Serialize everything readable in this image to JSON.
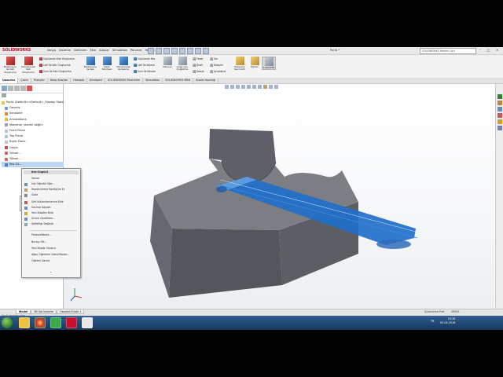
{
  "app": {
    "logo_text": "SOLIDWORKS",
    "document_title": "Part4 *",
    "search_placeholder": "SOLIDWORKS Yardım'ı Ara",
    "window_buttons": [
      "–",
      "□",
      "×"
    ]
  },
  "menu": [
    "Dosya",
    "Düzenle",
    "Görünüm",
    "Ekle",
    "Araçlar",
    "Simulation",
    "Pencere",
    "Yardım"
  ],
  "ribbon": {
    "large": [
      {
        "label": "Ekstrüzyon\nile Katı\nOluşturma",
        "icon": "extrude-boss-icon"
      },
      {
        "label": "Döndürerek\nKatı\nOluşturma",
        "icon": "revolve-boss-icon"
      },
      {
        "label": "Ekstrüzyon\nile Kes",
        "icon": "extrude-cut-icon"
      },
      {
        "label": "Delik\nSihirbazı",
        "icon": "hole-wizard-icon"
      },
      {
        "label": "Döndürerek\nile Kesme",
        "icon": "revolve-cut-icon"
      },
      {
        "label": "Referans\nGeometri",
        "icon": "reference-geometry-icon"
      },
      {
        "label": "Eğriler",
        "icon": "curves-icon"
      },
      {
        "label": "Instant3D",
        "icon": "instant3d-icon"
      }
    ],
    "small_col1": [
      "Süpürerek Katı Oluşturma",
      "Loft İle Katı Oluşturma",
      "Sınır İle Katı Oluşturma"
    ],
    "small_col2": [
      "Süpürerek Kes",
      "Loft İle Kesme",
      "Sınır İle Kesme"
    ],
    "small_col3": [
      "Radyus",
      "Doğrusal Çoğaltma"
    ],
    "small_col4": [
      "Feder",
      "Draft",
      "Kabuk"
    ],
    "small_col5": [
      "Sar",
      "Kesişim",
      "Aynalama"
    ]
  },
  "tabs": [
    "Unsurlar",
    "Çizim",
    "Yüzeyler",
    "Kalıp Araçları",
    "Hesapla",
    "DimXpert",
    "SOLIDWORKS Eklentileri",
    "Simulation",
    "SOLIDWORKS MBD",
    "Analiz Hazırlığı"
  ],
  "active_tab": "Unsurlar",
  "tree": [
    {
      "label": "Part4 (Default<<Default>_Display State",
      "icon": "part-icon"
    },
    {
      "label": "Geçmiş",
      "icon": "history-icon"
    },
    {
      "label": "Sensörler",
      "icon": "sensor-icon"
    },
    {
      "label": "Annotations",
      "icon": "annotations-icon"
    },
    {
      "label": "Malzeme <belirli değil>",
      "icon": "material-icon"
    },
    {
      "label": "Front Plane",
      "icon": "plane-icon"
    },
    {
      "label": "Top Plane",
      "icon": "plane-icon"
    },
    {
      "label": "Right Plane",
      "icon": "plane-icon"
    },
    {
      "label": "Origin",
      "icon": "origin-icon"
    },
    {
      "label": "Yüksel...",
      "icon": "feature-icon"
    },
    {
      "label": "Yüksel...",
      "icon": "feature-icon"
    },
    {
      "label": "Kes-Sü...",
      "icon": "sweep-cut-icon"
    }
  ],
  "context_menu": {
    "header": "Kes-Süpür2",
    "items": [
      "Yorum",
      "Üst Öğe/Alt Öğe...",
      "Yapılandırma Konfigüre Et",
      "Gizle",
      "Şirk Kullanılanlarına Ekle",
      "Seçime Kaydet",
      "Yeni Klasöre Ekle",
      "Ürünü Özellikleri...",
      "Şeffaflığı Değiştir",
      "FeatureWorks...",
      "Burayı Git...",
      "Yeni Klasör Oluştur",
      "Ağaç Öğelerini Gizle/Göster...",
      "Öğeleri Daralt"
    ]
  },
  "bottom_tabs": [
    "Model",
    "3B Görünümler",
    "Hareket Etüdü 1"
  ],
  "active_bottom_tab": "Model",
  "status": {
    "left": "Seçili girişleri çıkar",
    "mode": "Düzenleme Part",
    "units": "MMGS"
  },
  "taskbar": {
    "time": "19:36",
    "date": "05.04.2016",
    "lang": "TR"
  },
  "colors": {
    "body_face_top": "#7b7b80",
    "body_face_front": "#5a5b60",
    "body_face_side": "#6a6b70",
    "sweep_highlight": "#1f6fc9",
    "brand": "#c8102e",
    "taskbar": "#1f4a78"
  }
}
